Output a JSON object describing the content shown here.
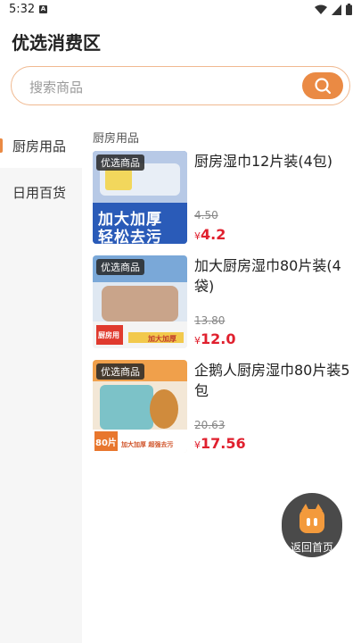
{
  "status_bar": {
    "time": "5:32",
    "notif": "A"
  },
  "page": {
    "title": "优选消费区"
  },
  "search": {
    "placeholder": "搜索商品"
  },
  "sidebar": {
    "items": [
      {
        "label": "厨房用品",
        "active": true
      },
      {
        "label": "日用百货",
        "active": false
      }
    ]
  },
  "section": {
    "title": "厨房用品"
  },
  "products": [
    {
      "tag": "优选商品",
      "name": "厨房湿巾12片装(4包)",
      "original_price": "4.50",
      "currency": "¥",
      "price": "4.2",
      "thumb_text_1": "加大加厚",
      "thumb_text_2": "轻松去污"
    },
    {
      "tag": "优选商品",
      "name": "加大厨房湿巾80片装(4袋)",
      "original_price": "13.80",
      "currency": "¥",
      "price": "12.0",
      "thumb_text_1": "厨房用",
      "thumb_text_2": "加大加厚"
    },
    {
      "tag": "优选商品",
      "name": "企鹅人厨房湿巾80片装5包",
      "original_price": "20.63",
      "currency": "¥",
      "price": "17.56",
      "thumb_text_1": "80片",
      "thumb_text_2": "加大加厚 超强去污"
    }
  ],
  "home_button": {
    "label": "返回首页"
  },
  "colors": {
    "accent": "#ea8a44",
    "price": "#e0202e",
    "sidebar_bg": "#f6f6f6"
  }
}
